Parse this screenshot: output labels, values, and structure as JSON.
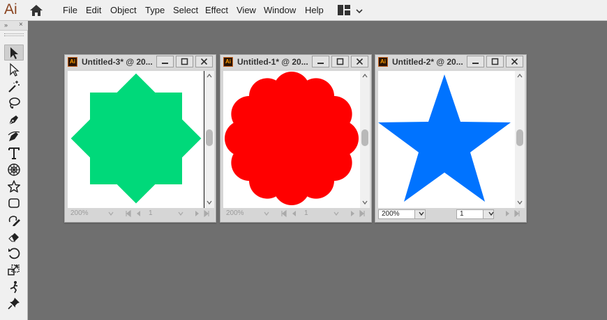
{
  "app": {
    "logo": "Ai",
    "menu": [
      "File",
      "Edit",
      "Object",
      "Type",
      "Select",
      "Effect",
      "View",
      "Window",
      "Help"
    ]
  },
  "tools_panel": {
    "collapse_glyph": "»",
    "close_glyph": "×",
    "tools": [
      "selection-tool",
      "direct-selection-tool",
      "magic-wand-tool",
      "lasso-tool",
      "pen-tool",
      "curvature-tool",
      "type-tool",
      "polar-grid-tool",
      "star-tool",
      "rectangle-tool",
      "shaper-tool",
      "eraser-tool",
      "rotate-tool",
      "scale-tool",
      "puppet-warp-tool",
      "pin-tool"
    ]
  },
  "windows": [
    {
      "title": "Untitled-3* @ 20...",
      "icon_text": "Ai",
      "active": false,
      "zoom": "200%",
      "page": "1",
      "shape": "eight-point-star",
      "fill": "#00d97a"
    },
    {
      "title": "Untitled-1* @ 20...",
      "icon_text": "Ai",
      "active": false,
      "zoom": "200%",
      "page": "1",
      "shape": "scalloped-circle",
      "fill": "#ff0000"
    },
    {
      "title": "Untitled-2* @ 20...",
      "icon_text": "Ai",
      "active": true,
      "zoom": "200%",
      "page": "1",
      "shape": "five-point-star",
      "fill": "#0073ff"
    }
  ]
}
